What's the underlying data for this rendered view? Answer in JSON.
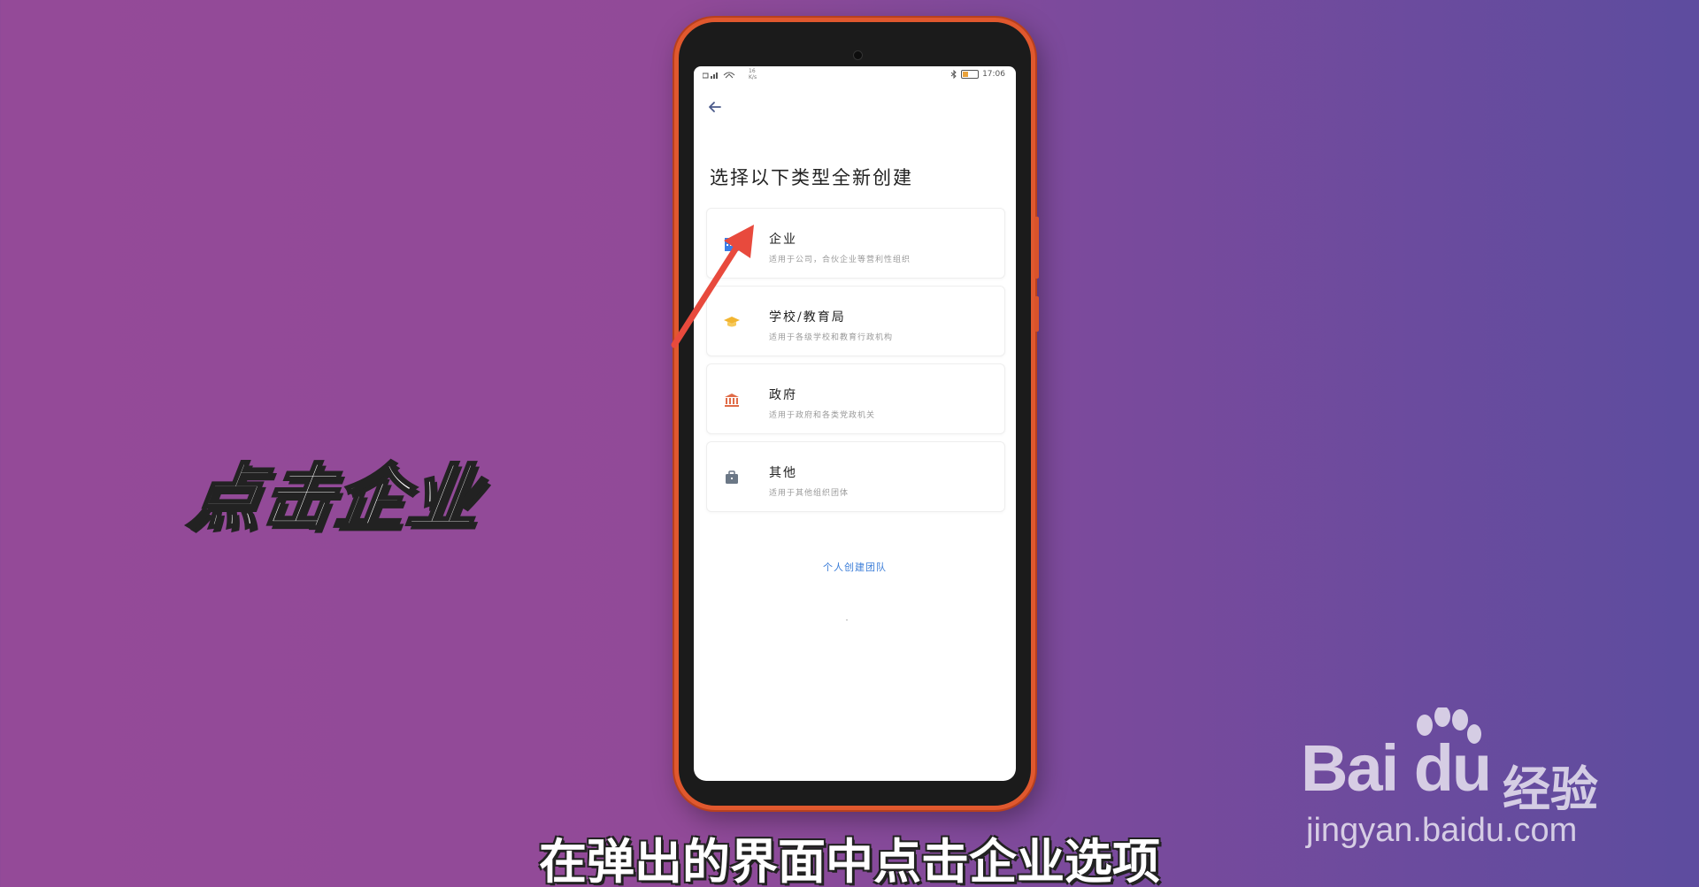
{
  "overlay": {
    "caption": "点击企业",
    "subtitle": "在弹出的界面中点击企业选项"
  },
  "watermark": {
    "brand": "Bai du",
    "brand_suffix": "经验",
    "url": "jingyan.baidu.com"
  },
  "status_bar": {
    "speed_value": "16",
    "speed_unit": "K/s",
    "time": "17:06"
  },
  "page": {
    "title": "选择以下类型全新创建"
  },
  "options": [
    {
      "name": "企业",
      "desc": "适用于公司，合伙企业等营利性组织",
      "icon": "building-icon",
      "color": "#3a7ee6"
    },
    {
      "name": "学校/教育局",
      "desc": "适用于各级学校和教育行政机构",
      "icon": "graduation-cap-icon",
      "color": "#f2b531"
    },
    {
      "name": "政府",
      "desc": "适用于政府和各类党政机关",
      "icon": "government-building-icon",
      "color": "#e06c48"
    },
    {
      "name": "其他",
      "desc": "适用于其他组织团体",
      "icon": "briefcase-icon",
      "color": "#6b7786"
    }
  ],
  "personal_link": "个人创建团队",
  "colors": {
    "accent_link": "#3b7dd8",
    "annotation_arrow": "#e84a3d",
    "phone_frame": "#e0582e"
  }
}
